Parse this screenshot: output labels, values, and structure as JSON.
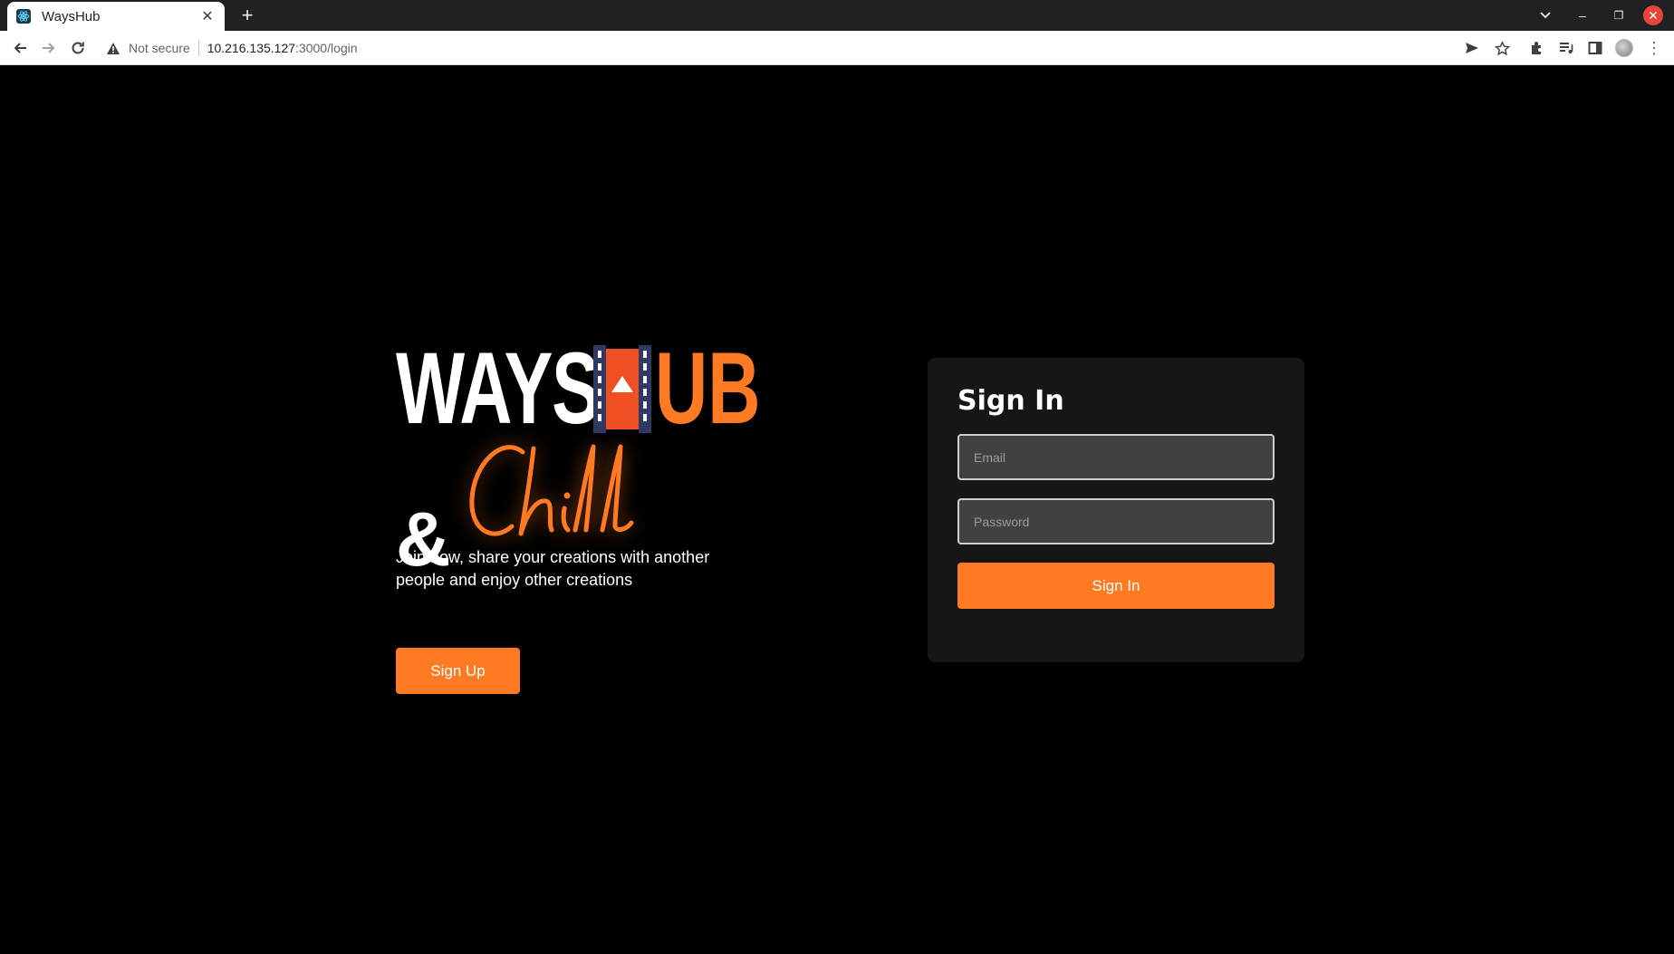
{
  "browser": {
    "tab_title": "WaysHub",
    "security_label": "Not secure",
    "url_host": "10.216.135.127",
    "url_path": ":3000/login"
  },
  "hero": {
    "logo_word1": "WAYS",
    "logo_word2": "UB",
    "logo_amp": "&",
    "logo_script": "Chill",
    "tagline": "Join now, share your creations with another people and enjoy other creations",
    "signup_label": "Sign Up"
  },
  "signin": {
    "title": "Sign In",
    "email_placeholder": "Email",
    "password_placeholder": "Password",
    "submit_label": "Sign In"
  },
  "colors": {
    "accent": "#ff7a22",
    "card_bg": "#161616",
    "input_bg": "#414141",
    "page_bg": "#000000"
  }
}
